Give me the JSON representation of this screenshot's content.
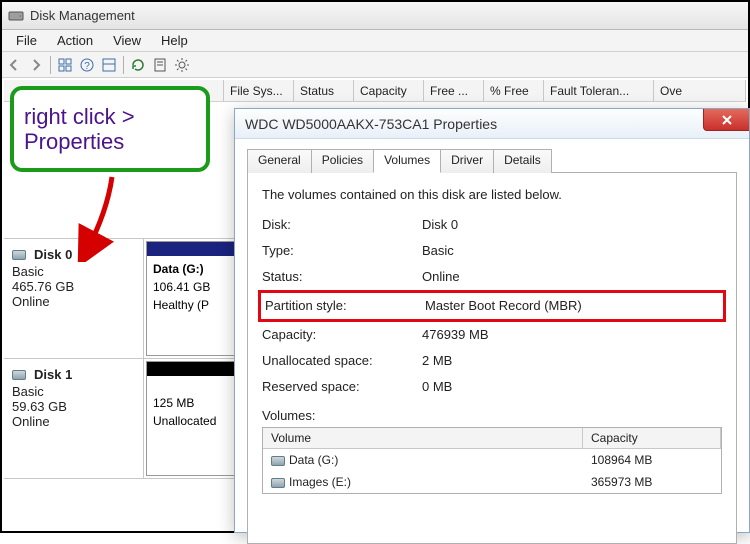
{
  "window": {
    "title": "Disk Management"
  },
  "menu": {
    "file": "File",
    "action": "Action",
    "view": "View",
    "help": "Help"
  },
  "columns": {
    "c0": "",
    "c1": "File Sys...",
    "c2": "Status",
    "c3": "Capacity",
    "c4": "Free ...",
    "c5": "% Free",
    "c6": "Fault Toleran...",
    "c7": "Ove"
  },
  "annotation": {
    "line1": "right click >",
    "line2": "Properties"
  },
  "disks": {
    "d0": {
      "name": "Disk 0",
      "type": "Basic",
      "size": "465.76 GB",
      "status": "Online",
      "vol": {
        "name": "Data  (G:)",
        "size": "106.41 GB",
        "info": "Healthy (P"
      }
    },
    "d1": {
      "name": "Disk 1",
      "type": "Basic",
      "size": "59.63 GB",
      "status": "Online",
      "vol": {
        "size": "125 MB",
        "info": "Unallocated"
      }
    }
  },
  "dialog": {
    "title": "WDC WD5000AAKX-753CA1 Properties",
    "tabs": {
      "general": "General",
      "policies": "Policies",
      "volumes": "Volumes",
      "driver": "Driver",
      "details": "Details"
    },
    "intro": "The volumes contained on this disk are listed below.",
    "fields": {
      "disk_k": "Disk:",
      "disk_v": "Disk 0",
      "type_k": "Type:",
      "type_v": "Basic",
      "status_k": "Status:",
      "status_v": "Online",
      "pstyle_k": "Partition style:",
      "pstyle_v": "Master Boot Record (MBR)",
      "cap_k": "Capacity:",
      "cap_v": "476939 MB",
      "unalloc_k": "Unallocated space:",
      "unalloc_v": "2 MB",
      "resv_k": "Reserved space:",
      "resv_v": "0 MB"
    },
    "volumes_label": "Volumes:",
    "vol_headers": {
      "name": "Volume",
      "cap": "Capacity"
    },
    "vol_rows": [
      {
        "name": "Data (G:)",
        "cap": "108964 MB"
      },
      {
        "name": "Images (E:)",
        "cap": "365973 MB"
      }
    ]
  }
}
